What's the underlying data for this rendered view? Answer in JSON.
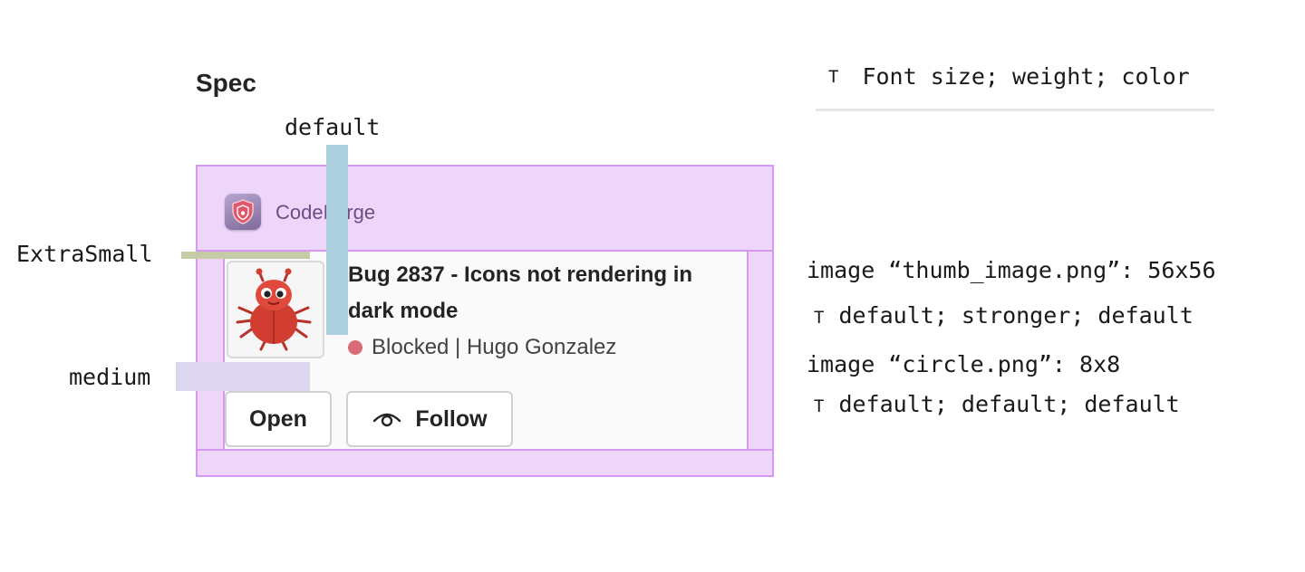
{
  "spec": {
    "title": "Spec"
  },
  "legend": {
    "icon": "T",
    "text": "Font size; weight; color"
  },
  "labels": {
    "default": "default",
    "extra_small": "ExtraSmall",
    "medium": "medium"
  },
  "card": {
    "app_name": "CodeForge",
    "app_icon": "shield-icon",
    "title_line1": "Bug 2837 - Icons not rendering in",
    "title_line2": "dark mode",
    "status": "Blocked | Hugo Gonzalez",
    "status_color": "#d86d78",
    "buttons": {
      "open": "Open",
      "follow": "Follow"
    }
  },
  "annotations": {
    "image1": "image “thumb_image.png”: 56x56",
    "text1_icon": "T",
    "text1": "default; stronger; default",
    "image2": "image “circle.png”: 8x8",
    "text2_icon": "T",
    "text2": "default; default; default"
  },
  "colors": {
    "overlay_fill": "#eed5fa",
    "overlay_border": "#d598ef",
    "default_bar": "#acd0dd",
    "extra_small_bar": "#c5cba6",
    "medium_bar": "#ddd6f0"
  }
}
